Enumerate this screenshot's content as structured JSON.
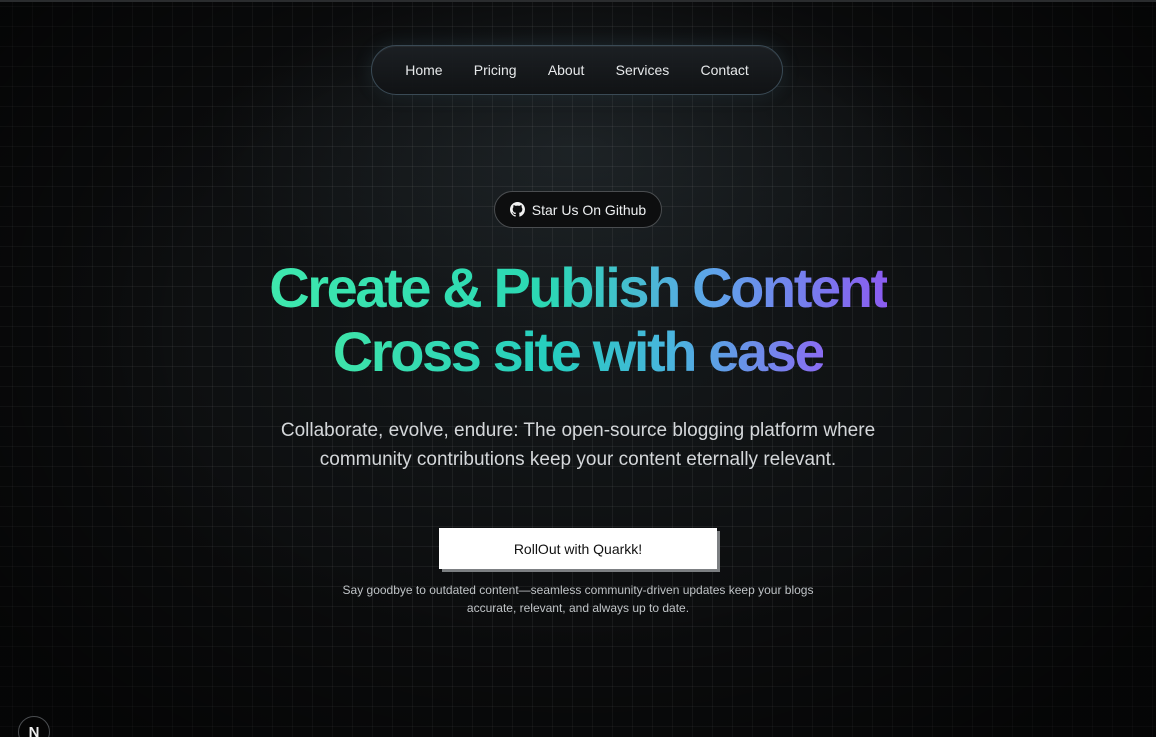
{
  "nav": {
    "items": [
      {
        "label": "Home"
      },
      {
        "label": "Pricing"
      },
      {
        "label": "About"
      },
      {
        "label": "Services"
      },
      {
        "label": "Contact"
      }
    ]
  },
  "github_button": {
    "icon": "github-icon",
    "label": "Star Us On Github"
  },
  "hero": {
    "line1": "Create & Publish Content",
    "line2": "Cross site with ease",
    "gradient_colors": [
      "#3ee8ad",
      "#2bd8b4",
      "#5fa3ea",
      "#8b5cf0"
    ]
  },
  "subheading": "Collaborate, evolve, endure: The open-source blogging platform where community contributions keep your content eternally relevant.",
  "cta": {
    "label": "RollOut with Quarkk!"
  },
  "note": "Say goodbye to outdated content—seamless community-driven updates keep your blogs accurate, relevant, and always up to date.",
  "corner_badge": {
    "label": "N",
    "icon": "nextjs-logo-icon"
  },
  "colors": {
    "background": "#0b0c0d",
    "nav_border": "#3a4a55",
    "cta_background": "#ffffff"
  }
}
